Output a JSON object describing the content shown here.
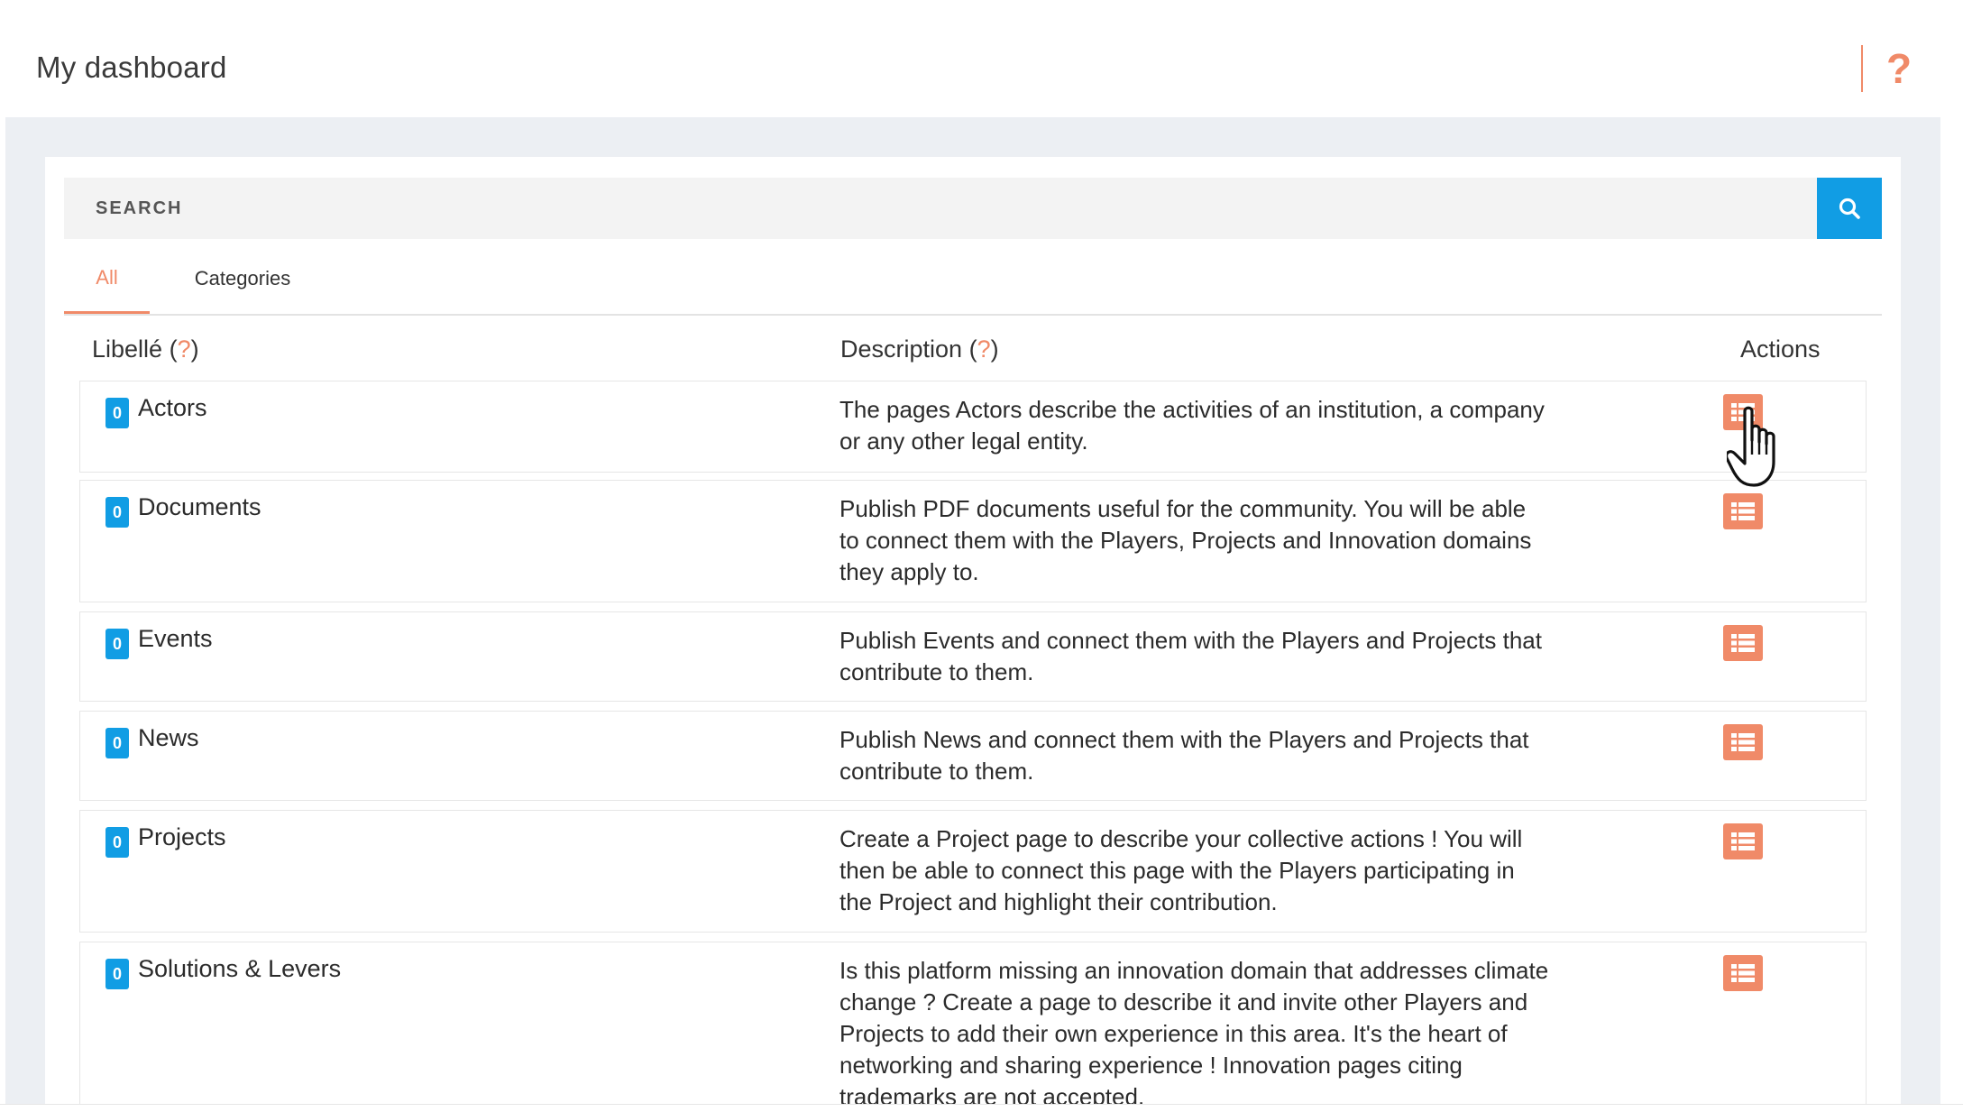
{
  "header": {
    "title": "My dashboard",
    "help_glyph": "?"
  },
  "search": {
    "placeholder": "SEARCH",
    "button_icon": "search-icon"
  },
  "tabs": [
    {
      "label": "All",
      "active": true
    },
    {
      "label": "Categories",
      "active": false
    }
  ],
  "table": {
    "headers": {
      "label": "Libellé",
      "description": "Description",
      "actions": "Actions",
      "help_glyph": "?"
    },
    "rows": [
      {
        "count": "0",
        "label": "Actors",
        "description": "The pages Actors describe the activities of an institution, a company or any other legal entity.",
        "action_icon": "list-icon"
      },
      {
        "count": "0",
        "label": "Documents",
        "description": "Publish PDF documents useful for the community. You will be able to connect them with the Players, Projects and Innovation domains they apply to.",
        "action_icon": "list-icon"
      },
      {
        "count": "0",
        "label": "Events",
        "description": "Publish Events and connect them with the Players and Projects that contribute to them.",
        "action_icon": "list-icon"
      },
      {
        "count": "0",
        "label": "News",
        "description": "Publish News and connect them with the Players and Projects that contribute to them.",
        "action_icon": "list-icon"
      },
      {
        "count": "0",
        "label": "Projects",
        "description": "Create a Project page to describe your collective actions ! You will then be able to connect this page with the Players participating in the Project and highlight their contribution.",
        "action_icon": "list-icon"
      },
      {
        "count": "0",
        "label": "Solutions & Levers",
        "description": "Is this platform missing an innovation domain that addresses climate change ? Create a page to describe it and invite other Players and Projects to add their own experience in this area. It's the heart of networking and sharing experience ! Innovation pages citing trademarks are not accepted.",
        "action_icon": "list-icon"
      }
    ]
  },
  "colors": {
    "accent": "#f08a68",
    "primary": "#119de4",
    "panel_bg": "#eceff3"
  }
}
